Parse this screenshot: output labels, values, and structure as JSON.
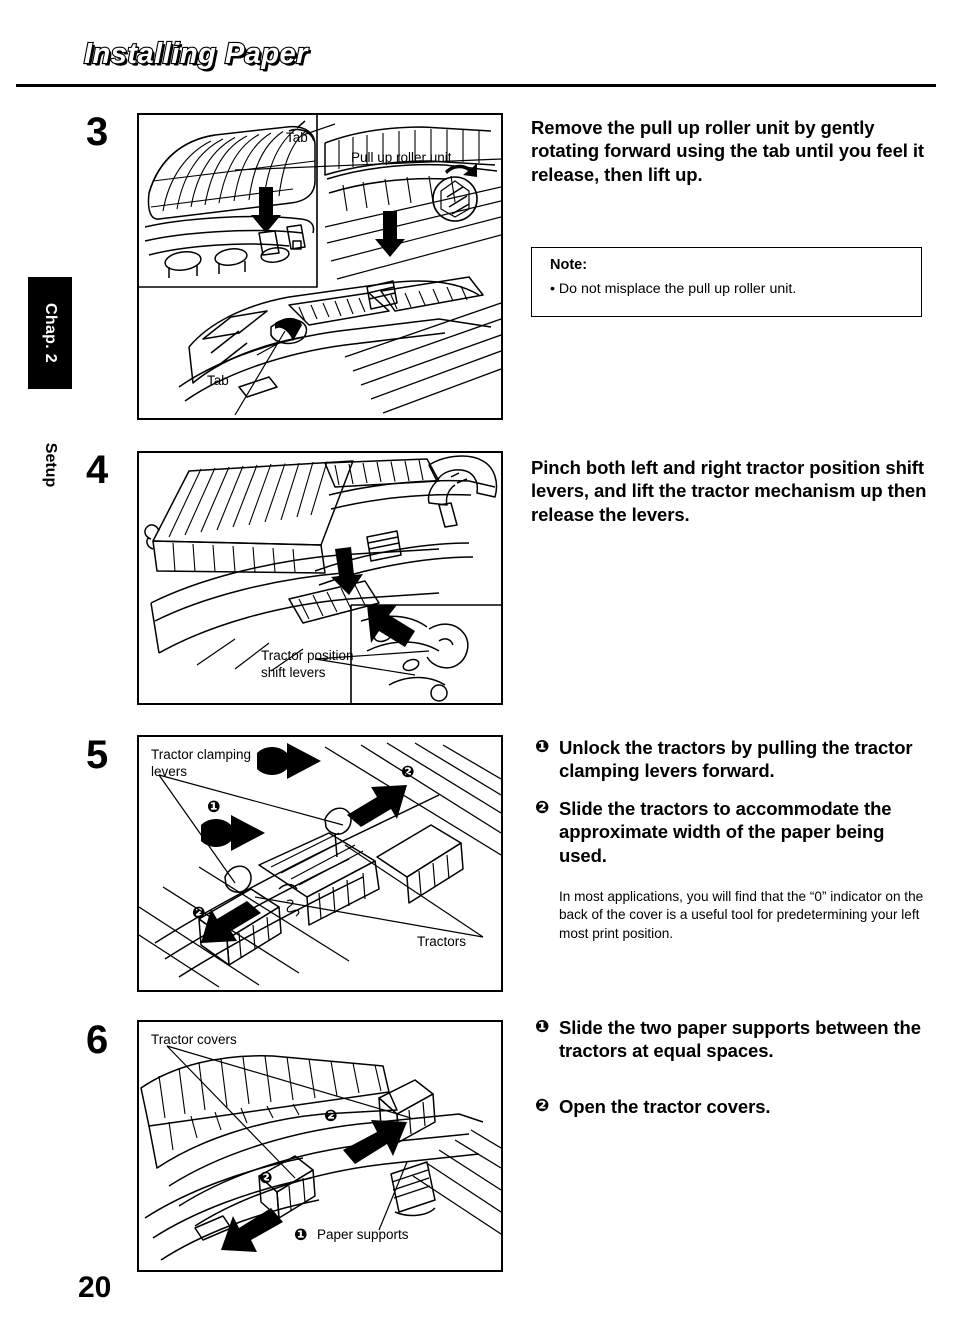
{
  "header": {
    "title": "Installing Paper"
  },
  "sidebar": {
    "chapter_tab": "Chap. 2",
    "section_tab": "Setup"
  },
  "page_number": "20",
  "steps": [
    {
      "number": "3",
      "figure_labels": {
        "tab_top": "Tab",
        "pull_up_roller_unit": "Pull up roller unit",
        "tab_bottom": "Tab"
      },
      "instruction": "Remove the pull up roller unit by gently rotating forward using the tab until you feel it release, then lift up.",
      "note": {
        "title": "Note:",
        "bullet": "• Do not misplace the pull up roller unit."
      }
    },
    {
      "number": "4",
      "figure_labels": {
        "tractor_position_shift_levers_line1": "Tractor position",
        "tractor_position_shift_levers_line2": "shift levers"
      },
      "instruction": "Pinch both left and right tractor position shift levers, and lift the tractor mechanism up then release the levers."
    },
    {
      "number": "5",
      "figure_labels": {
        "tractor_clamping_levers_line1": "Tractor clamping",
        "tractor_clamping_levers_line2": "levers",
        "tractors": "Tractors",
        "callout_1": "❶",
        "callout_2": "❷"
      },
      "items": [
        {
          "marker": "❶",
          "text": "Unlock the tractors by pulling the tractor clamping levers forward."
        },
        {
          "marker": "❷",
          "text": "Slide the tractors to accommodate the approximate width of the paper being used."
        }
      ],
      "small_note": "In most applications, you will find that the “0” indicator on the back of the cover is a useful tool for predetermining your left most print position."
    },
    {
      "number": "6",
      "figure_labels": {
        "tractor_covers": "Tractor covers",
        "paper_supports_marker": "❶",
        "paper_supports": "Paper supports",
        "callout_2a": "❷",
        "callout_2b": "❷"
      },
      "items": [
        {
          "marker": "❶",
          "text": "Slide the two  paper supports between the tractors at equal spaces."
        },
        {
          "marker": "❷",
          "text": "Open the tractor covers."
        }
      ]
    }
  ],
  "colors": {
    "ink": "#000000",
    "paper": "#ffffff"
  }
}
